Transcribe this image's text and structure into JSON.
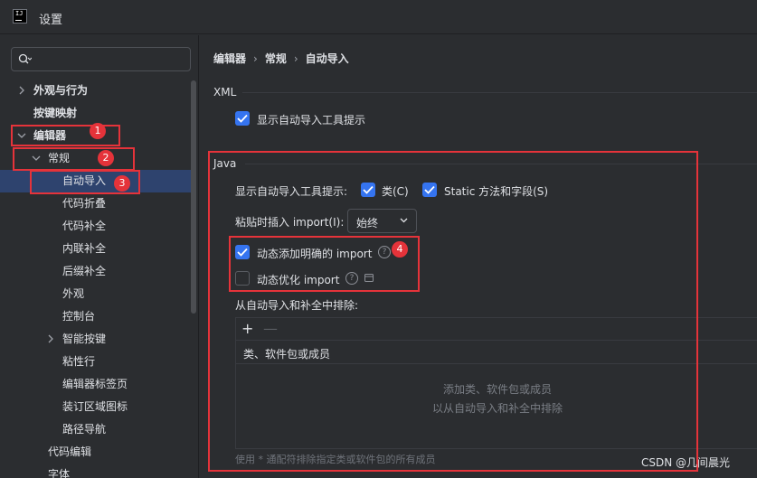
{
  "window": {
    "title": "设置",
    "logo_text": "IJ"
  },
  "search": {
    "value": "",
    "placeholder": ""
  },
  "sidebar": {
    "items": [
      {
        "label": "外观与行为"
      },
      {
        "label": "按键映射"
      },
      {
        "label": "编辑器"
      },
      {
        "label": "常规"
      },
      {
        "label": "自动导入"
      },
      {
        "label": "代码折叠"
      },
      {
        "label": "代码补全"
      },
      {
        "label": "内联补全"
      },
      {
        "label": "后缀补全"
      },
      {
        "label": "外观"
      },
      {
        "label": "控制台"
      },
      {
        "label": "智能按键"
      },
      {
        "label": "粘性行"
      },
      {
        "label": "编辑器标签页"
      },
      {
        "label": "装订区域图标"
      },
      {
        "label": "路径导航"
      },
      {
        "label": "代码编辑"
      },
      {
        "label": "字体"
      }
    ]
  },
  "breadcrumb": {
    "part1": "编辑器",
    "part2": "常规",
    "part3": "自动导入"
  },
  "xml": {
    "title": "XML",
    "show_popup_label": "显示自动导入工具提示",
    "show_popup_checked": true
  },
  "java": {
    "title": "Java",
    "show_popup_label": "显示自动导入工具提示:",
    "classes_label": "类(C)",
    "classes_checked": true,
    "static_label": "Static 方法和字段(S)",
    "static_checked": true,
    "paste_label": "粘贴时插入 import(I):",
    "paste_value": "始终",
    "add_unambiguous_label": "动态添加明确的 import",
    "add_unambiguous_checked": true,
    "optimize_label": "动态优化 import",
    "optimize_checked": false,
    "exclude_label": "从自动导入和补全中排除:",
    "add_button": "+",
    "remove_button": "—",
    "table_header": "类、软件包或成员",
    "empty_line1": "添加类、软件包或成员",
    "empty_line2": "以从自动导入和补全中排除",
    "footnote": "使用 * 通配符排除指定类或软件包的所有成员"
  },
  "annotations": {
    "b1": "1",
    "b2": "2",
    "b3": "3",
    "b4": "4"
  },
  "watermark": "CSDN @几间晨光",
  "colors": {
    "accent": "#3574f0",
    "annotation": "#e5333a",
    "selection": "#2e436e"
  }
}
